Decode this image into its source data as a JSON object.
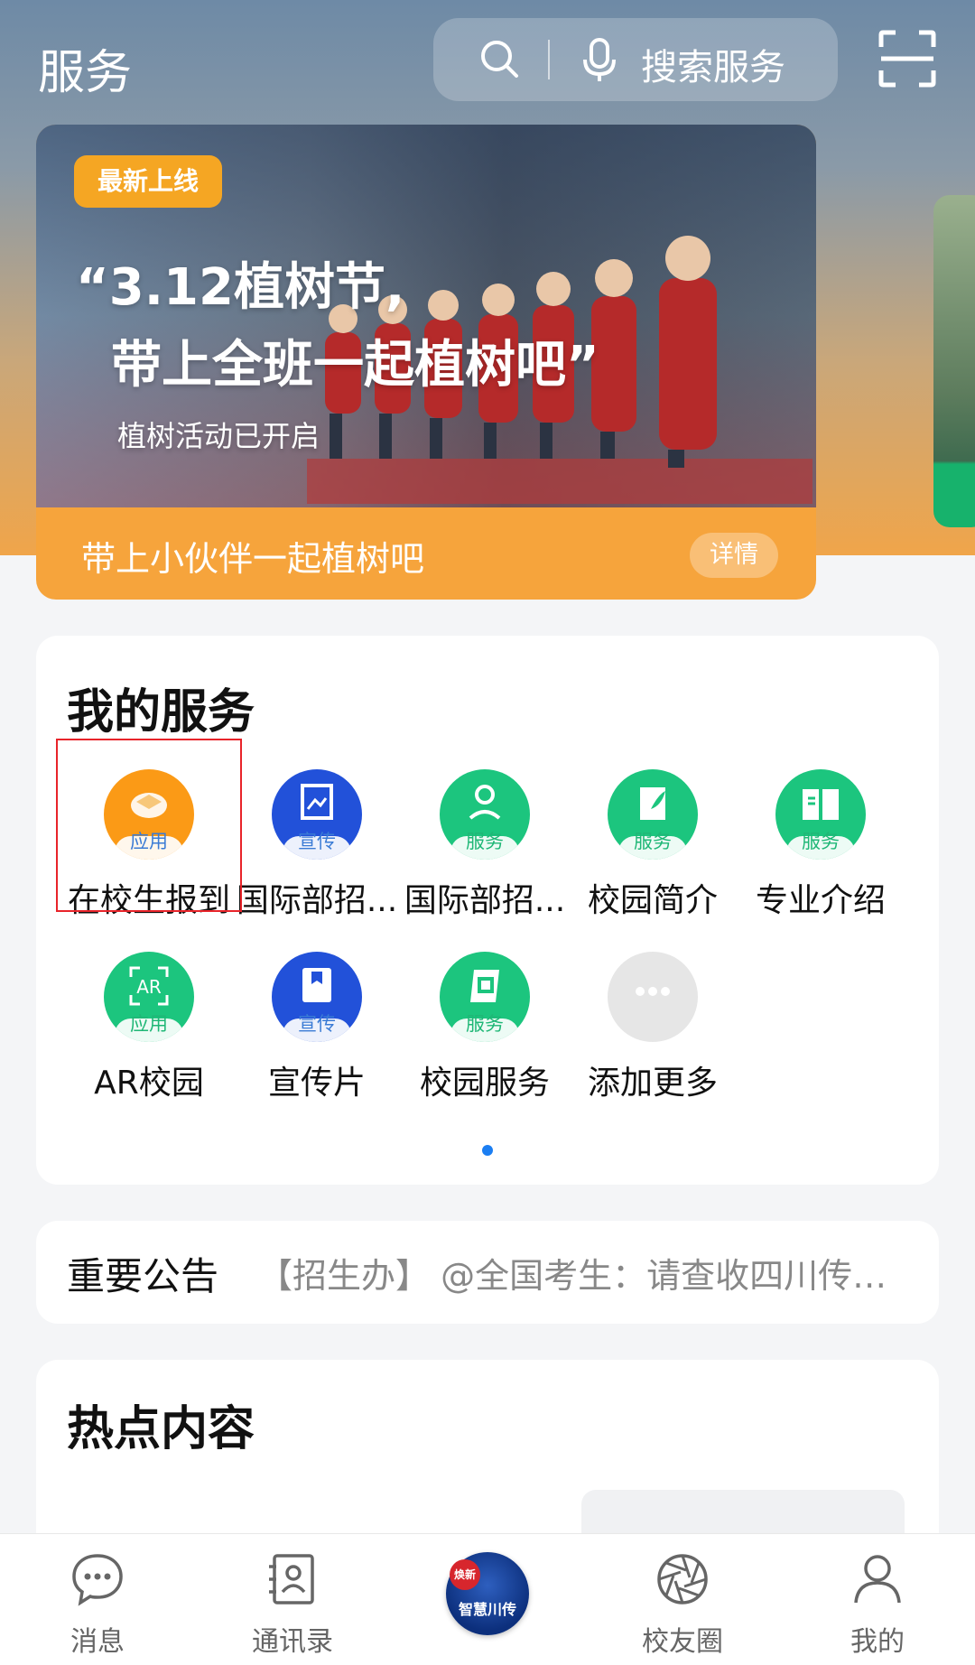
{
  "header": {
    "title": "服务",
    "search_placeholder": "搜索服务"
  },
  "banner": {
    "badge": "最新上线",
    "headline": "“3.12植树节,\n  带上全班一起植树吧”",
    "subtitle": "植树活动已开启",
    "caption": "带上小伙伴一起植树吧",
    "detail_button": "详情"
  },
  "my_services": {
    "title": "我的服务",
    "items": [
      {
        "label": "在校生报到",
        "tag": "应用",
        "icon": "graduation-cap-icon",
        "color": "#fb9a16"
      },
      {
        "label": "国际部招...",
        "tag": "宣传",
        "icon": "image-frame-icon",
        "color": "#2251d9"
      },
      {
        "label": "国际部招...",
        "tag": "服务",
        "icon": "person-reading-icon",
        "color": "#1cc57e"
      },
      {
        "label": "校园简介",
        "tag": "服务",
        "icon": "book-leaf-icon",
        "color": "#1cc57e"
      },
      {
        "label": "专业介绍",
        "tag": "服务",
        "icon": "open-book-icon",
        "color": "#1cc57e"
      },
      {
        "label": "AR校园",
        "tag": "应用",
        "icon": "ar-icon",
        "color": "#1cc57e"
      },
      {
        "label": "宣传片",
        "tag": "宣传",
        "icon": "video-book-icon",
        "color": "#2251d9"
      },
      {
        "label": "校园服务",
        "tag": "服务",
        "icon": "campus-service-icon",
        "color": "#1cc57e"
      },
      {
        "label": "添加更多",
        "tag": "",
        "icon": "more-dots-icon",
        "color": "#e6e6e6"
      }
    ]
  },
  "notice": {
    "title": "重要公告",
    "text": "【招生办】 @全国考生：请查收四川传媒..."
  },
  "hot": {
    "title": "热点内容"
  },
  "bottom_nav": {
    "items": [
      {
        "label": "消息",
        "icon": "message-icon"
      },
      {
        "label": "通讯录",
        "icon": "contacts-icon"
      },
      {
        "label": "智慧川传",
        "icon": "app-logo-icon",
        "corner": "焕新"
      },
      {
        "label": "校友圈",
        "icon": "aperture-icon"
      },
      {
        "label": "我的",
        "icon": "user-icon"
      }
    ]
  },
  "colors": {
    "accent_blue": "#1b7ef2",
    "highlight_red": "#e8242a",
    "banner_orange": "#f6a43c"
  }
}
